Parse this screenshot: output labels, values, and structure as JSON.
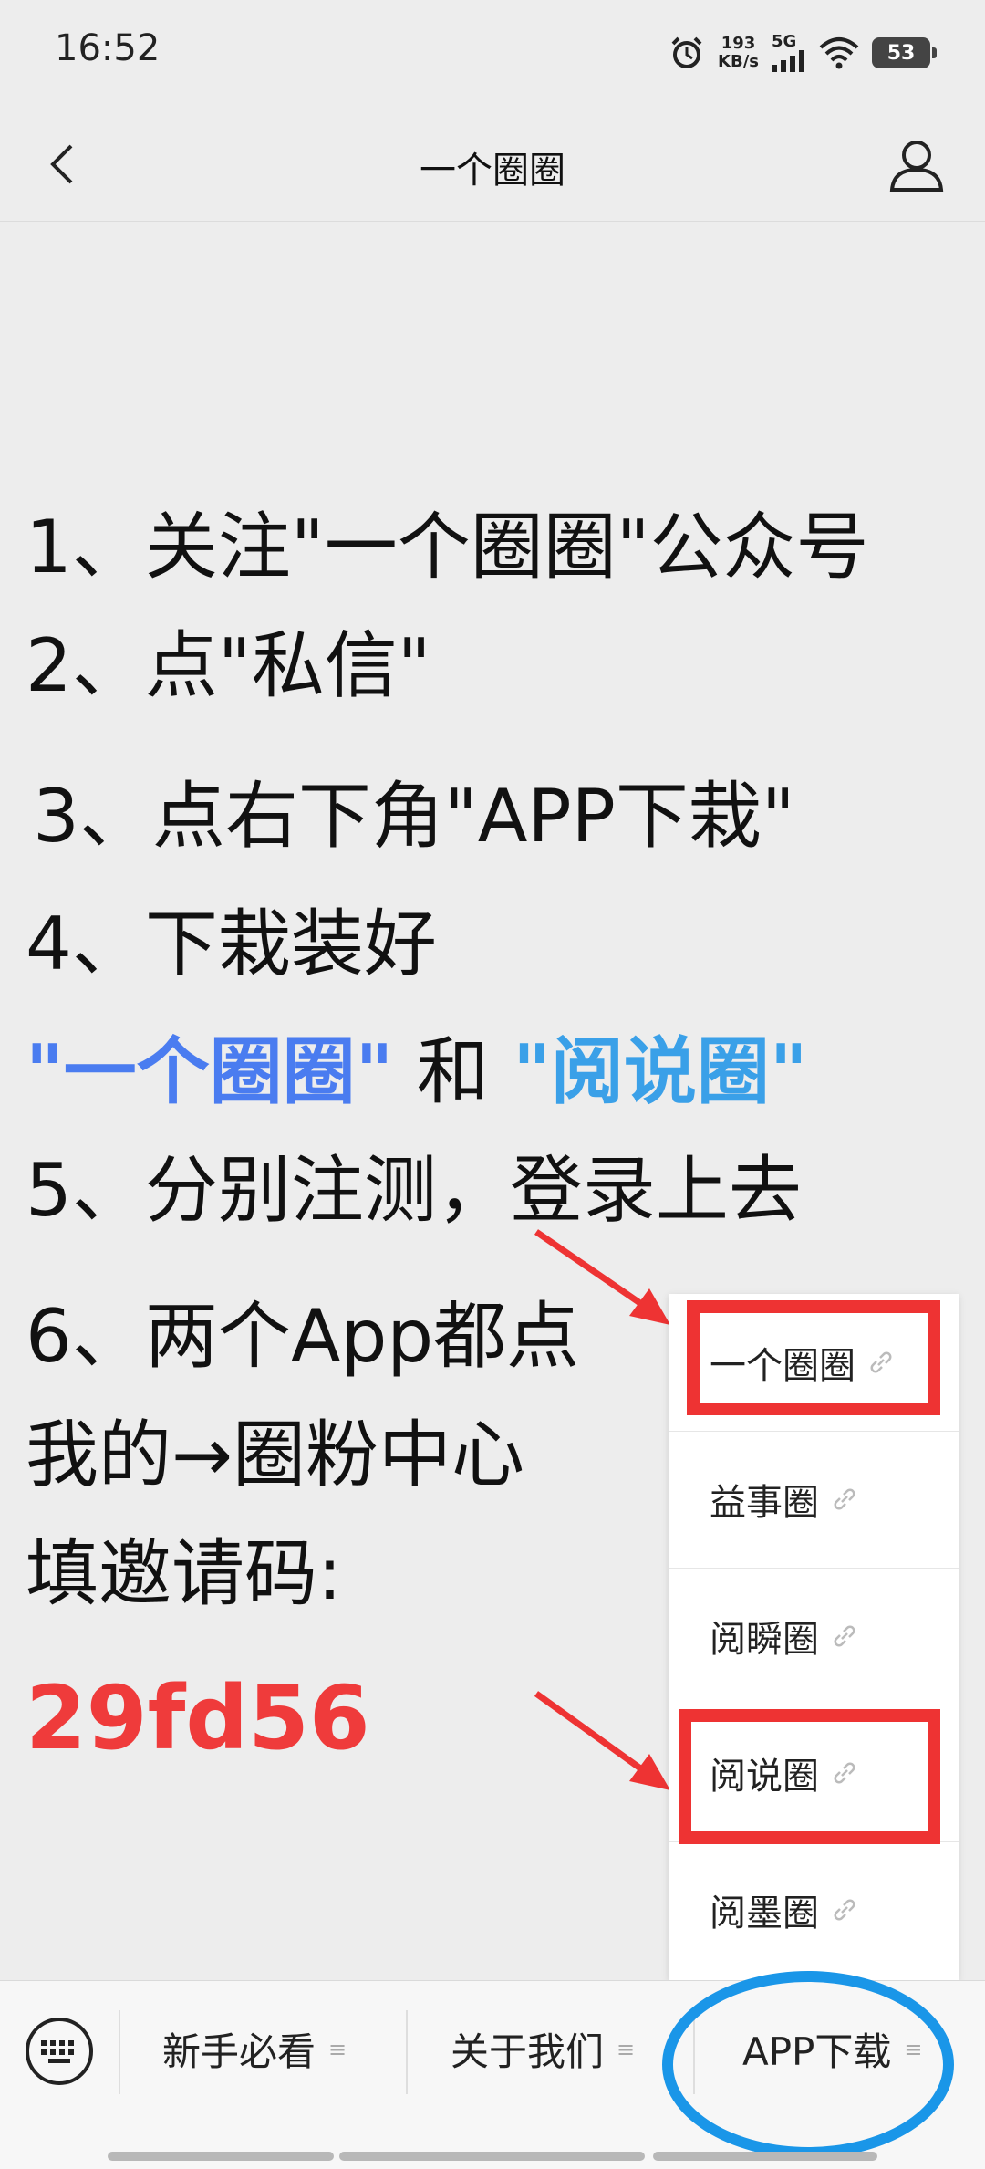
{
  "status_bar": {
    "time": "16:52",
    "net_speed": "193",
    "net_unit": "KB/s",
    "net_type": "5G",
    "battery": "53"
  },
  "nav": {
    "title": "一个圈圈"
  },
  "instructions": {
    "line1": "1、关注\"一个圈圈\"公众号",
    "line2": "2、点\"私信\"",
    "line3": "3、点右下角\"APP下栽\"",
    "line4": "4、下栽装好",
    "app1": "\"一个圈圈\"",
    "and": "和",
    "app2": "\"阅说圈\"",
    "line5": "5、分别注测，登录上去",
    "line6": "6、两个App都点",
    "line7": "我的→圈粉中心",
    "line8": "填邀请码:",
    "invite_code": "29fd56"
  },
  "popup_menu": {
    "items": [
      {
        "label": "一个圈圈"
      },
      {
        "label": "益事圈"
      },
      {
        "label": "阅瞬圈"
      },
      {
        "label": "阅说圈"
      },
      {
        "label": "阅墨圈"
      }
    ]
  },
  "bottom_menu": {
    "items": [
      {
        "label": "新手必看"
      },
      {
        "label": "关于我们"
      },
      {
        "label": "APP下载"
      }
    ]
  },
  "colors": {
    "annotation_red": "#ee3333",
    "annotation_blue": "#1a96e8",
    "invite_code": "#ef3b3b",
    "highlight_blue_1": "#4a7cf0",
    "highlight_blue_2": "#3aa0e8"
  }
}
